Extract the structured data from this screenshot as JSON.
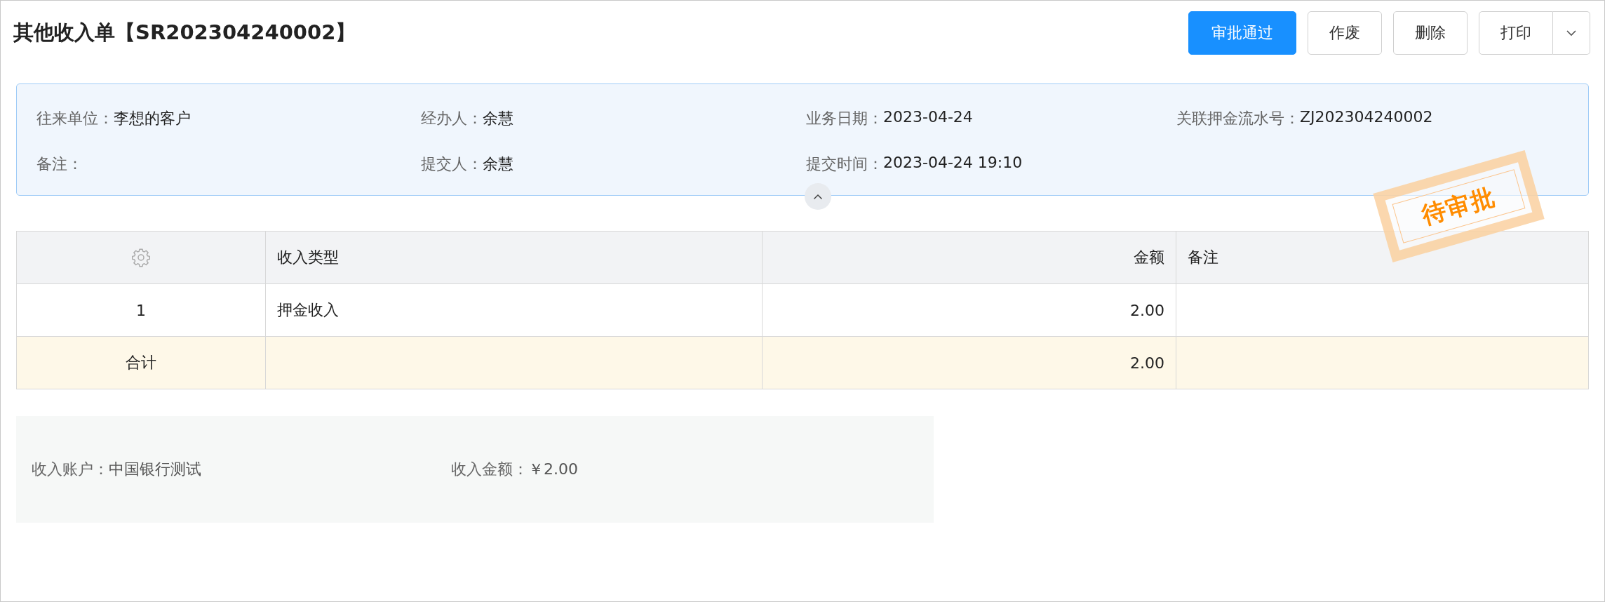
{
  "title": "其他收入单【SR202304240002】",
  "actions": [
    {
      "label": "审批通过",
      "kind": "primary"
    },
    {
      "label": "作废",
      "kind": "default"
    },
    {
      "label": "删除",
      "kind": "default"
    },
    {
      "label": "打印",
      "kind": "split"
    }
  ],
  "info": [
    {
      "label": "往来单位：",
      "value": "李想的客户"
    },
    {
      "label": "经办人：",
      "value": "余慧"
    },
    {
      "label": "业务日期：",
      "value": "2023-04-24"
    },
    {
      "label": "关联押金流水号：",
      "value": "ZJ202304240002"
    },
    {
      "label": "备注："
    },
    {
      "label": "提交人：",
      "value": "余慧"
    },
    {
      "label": "提交时间：",
      "value": "2023-04-24 19:10"
    }
  ],
  "stamp": "待审批",
  "table": {
    "columns": [
      {
        "kind": "settings"
      },
      {
        "label": "收入类型",
        "kind": "text"
      },
      {
        "label": "金额",
        "kind": "amount"
      },
      {
        "label": "备注",
        "kind": "text"
      }
    ],
    "rows": [
      {
        "cells": [
          "1",
          "押金收入",
          "2.00",
          ""
        ]
      }
    ],
    "total": {
      "label": "合计",
      "cells": [
        "",
        "2.00",
        ""
      ]
    }
  },
  "account": [
    {
      "label": "收入账户：",
      "value": "中国银行测试"
    },
    {
      "label": "收入金额：",
      "value": "￥2.00"
    }
  ]
}
